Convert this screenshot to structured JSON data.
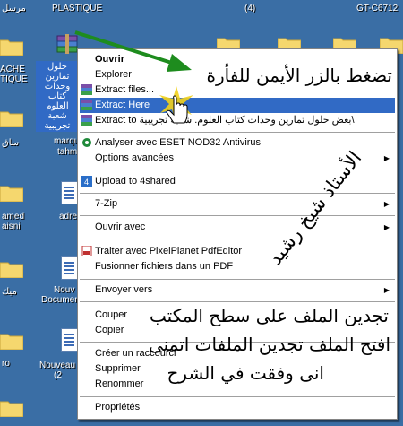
{
  "desktop": {
    "top_labels": [
      "مرسل",
      "PLASTIQUE",
      "(4)",
      "GT-C6712"
    ],
    "left_labels": [
      "ACHE",
      "TIQUE",
      "ساق",
      "amed",
      "aisni",
      "ميك",
      "ro"
    ],
    "mid_labels": [
      "marqu",
      "tahm",
      "adre",
      "Nouv",
      "Documen",
      "Nouveau",
      "(2"
    ],
    "selected_file_label": "حلول تمارين وحدات كتاب العلوم شعبة تجريبية"
  },
  "context_menu": {
    "items": [
      {
        "label": "Ouvrir",
        "bold": true
      },
      {
        "label": "Explorer"
      },
      {
        "label": "Extract files...",
        "icon": "winrar-icon"
      },
      {
        "label": "Extract Here",
        "icon": "winrar-icon",
        "highlighted": true
      },
      {
        "label": "Extract to بعض حلول تمارين وحدات كتاب العلوم. شعبة تجريبية\\",
        "icon": "winrar-icon"
      },
      {
        "label": "Analyser avec ESET NOD32 Antivirus",
        "icon": "eset-icon"
      },
      {
        "label": "Options avancées",
        "submenu": true
      },
      {
        "label": "Upload to 4shared",
        "icon": "4shared-icon"
      },
      {
        "label": "7-Zip",
        "submenu": true
      },
      {
        "label": "Ouvrir avec",
        "submenu": true
      },
      {
        "label": "Traiter avec PixelPlanet PdfEditor",
        "icon": "pdf-icon"
      },
      {
        "label": "Fusionner fichiers dans un PDF"
      },
      {
        "label": "Envoyer vers",
        "submenu": true
      },
      {
        "label": "Couper"
      },
      {
        "label": "Copier"
      },
      {
        "label": "Créer un raccourci"
      },
      {
        "label": "Supprimer"
      },
      {
        "label": "Renommer"
      },
      {
        "label": "Propriétés"
      }
    ]
  },
  "annotations": {
    "right_click_note": "تضغط بالزر الأيمن للفأرة",
    "author": "الأستاذ شيخ رشيد",
    "line1": "تجدين الملف على سطح المكتب",
    "line2": "افتح الملف تجدين الملفات اتمنى",
    "line3": "انى وفقت في الشرح"
  },
  "colors": {
    "desktop": "#3a6ea5",
    "highlight": "#316ac5",
    "arrow": "#1e8c1e",
    "cursor_glow": "#f2d21b"
  }
}
